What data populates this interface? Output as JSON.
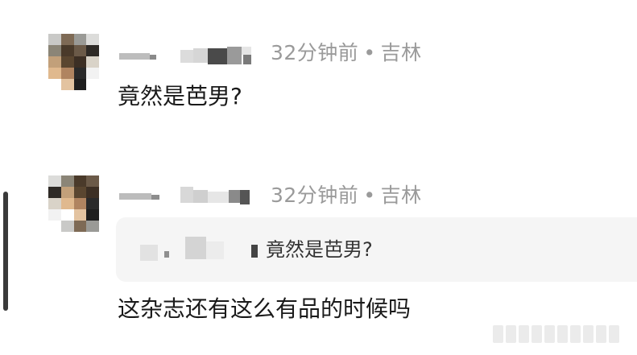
{
  "comments": [
    {
      "time_ago": "32分钟前",
      "separator": "•",
      "location": "吉林",
      "text": "竟然是芭男?"
    },
    {
      "time_ago": "32分钟前",
      "separator": "•",
      "location": "吉林",
      "quote_text": "竟然是芭男?",
      "text": "这杂志还有这么有品的时候吗"
    }
  ],
  "avatar_mosaic_colors": [
    "#c9c9c7",
    "#7e6a55",
    "#9a9a96",
    "#dcdcda",
    "#8b8577",
    "#4a3a2a",
    "#6b5a48",
    "#2e2a26",
    "#c2a07a",
    "#5a4630",
    "#3c2f24",
    "#d9d3c8",
    "#e0b98e",
    "#b08460",
    "#2a2a2a",
    "#f2f2f2",
    "#ffffff",
    "#e3c3a0",
    "#1e1e1e",
    "#ffffff"
  ]
}
